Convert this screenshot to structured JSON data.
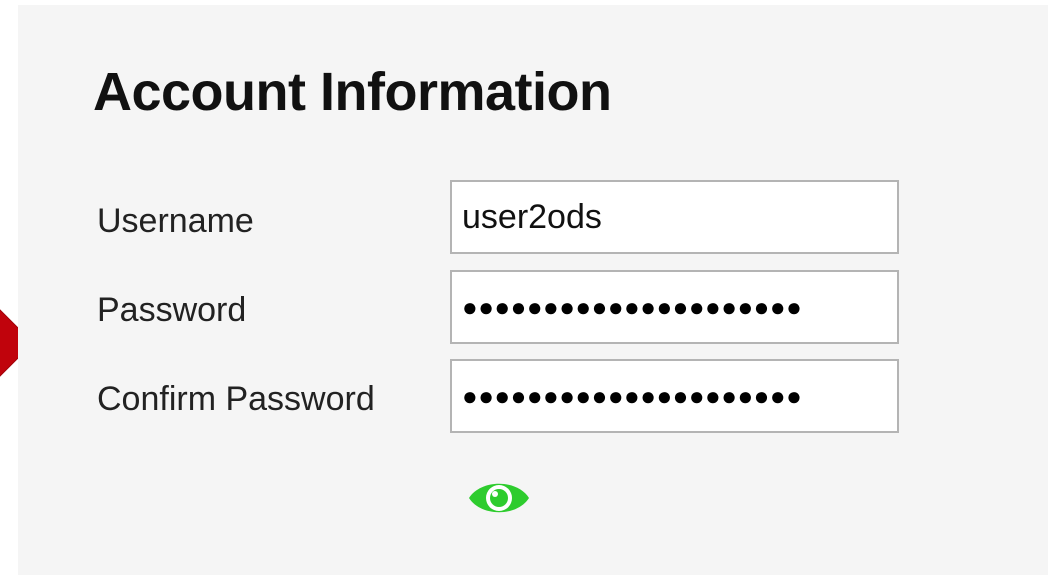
{
  "form": {
    "title": "Account Information",
    "fields": [
      {
        "label": "Username",
        "value": "user2ods",
        "type": "text"
      },
      {
        "label": "Password",
        "value": "●●●●●●●●●●●●●●●●●●●●●",
        "type": "password"
      },
      {
        "label": "Confirm Password",
        "value": "●●●●●●●●●●●●●●●●●●●●●",
        "type": "password"
      }
    ],
    "toggle_icon": "eye-icon",
    "accent_color": "#2ecc2e"
  },
  "marker": {
    "color": "#c0030c",
    "icon": "arrow-marker"
  }
}
